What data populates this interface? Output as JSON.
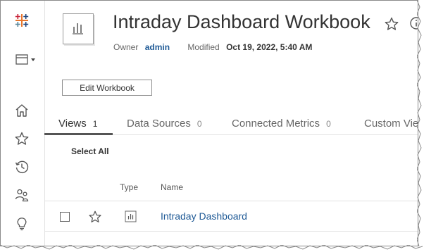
{
  "workbook": {
    "title": "Intraday Dashboard Workbook",
    "owner_label": "Owner",
    "owner": "admin",
    "modified_label": "Modified",
    "modified": "Oct 19, 2022, 5:40 AM"
  },
  "actions": {
    "edit_label": "Edit Workbook"
  },
  "tabs": [
    {
      "label": "Views",
      "count": "1",
      "active": true
    },
    {
      "label": "Data Sources",
      "count": "0",
      "active": false
    },
    {
      "label": "Connected Metrics",
      "count": "0",
      "active": false
    },
    {
      "label": "Custom Vie",
      "count": "",
      "active": false
    }
  ],
  "list": {
    "select_all_label": "Select All",
    "columns": {
      "type": "Type",
      "name": "Name"
    },
    "rows": [
      {
        "name": "Intraday Dashboard",
        "type_icon": "view-icon",
        "selected": false,
        "favorite": false
      }
    ]
  },
  "sidebar": {
    "items": [
      {
        "icon": "tableau-logo-icon"
      },
      {
        "icon": "site-switcher-icon"
      },
      {
        "icon": "home-icon"
      },
      {
        "icon": "favorites-star-icon"
      },
      {
        "icon": "recents-clock-icon"
      },
      {
        "icon": "groups-people-icon"
      },
      {
        "icon": "recommendations-lightbulb-icon"
      }
    ]
  },
  "colors": {
    "link": "#1f5a96",
    "text": "#333333",
    "logo_blue": "#1f457e",
    "logo_orange": "#e8762c",
    "logo_red": "#c72037",
    "logo_teal": "#59879b"
  }
}
